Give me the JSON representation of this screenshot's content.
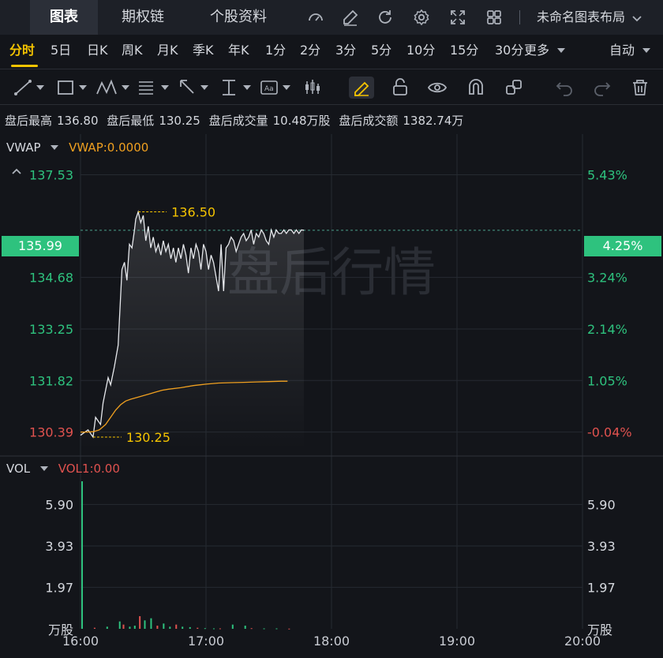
{
  "topbar": {
    "tabs": [
      "图表",
      "期权链",
      "个股资料"
    ],
    "active_tab": "图表",
    "icons": [
      "speedometer-icon",
      "pencil-icon",
      "refresh-icon",
      "gear-icon",
      "fullscreen-icon",
      "grid-icon"
    ],
    "layout_label": "未命名图表布局"
  },
  "periods": {
    "items": [
      "分时",
      "5日",
      "日K",
      "周K",
      "月K",
      "季K",
      "年K",
      "1分",
      "2分",
      "3分",
      "5分",
      "10分",
      "15分",
      "30分"
    ],
    "active": "分时",
    "more_label": "更多",
    "auto_label": "自动"
  },
  "tools": [
    "trendline-icon",
    "rectangle-icon",
    "pattern-icon",
    "fib-icon",
    "arrow-icon",
    "measure-icon",
    "text-icon",
    "candle-icon",
    "highlighter-icon",
    "lock-icon",
    "eye-icon",
    "magnet-icon",
    "link-icon",
    "undo-icon",
    "redo-icon",
    "trash-icon"
  ],
  "info": {
    "high_label": "盘后最高",
    "high_value": "136.80",
    "low_label": "盘后最低",
    "low_value": "130.25",
    "volume_label": "盘后成交量",
    "volume_value": "10.48万股",
    "amount_label": "盘后成交额",
    "amount_value": "1382.74万"
  },
  "indicators": {
    "main_name": "VWAP",
    "main_value": "VWAP:0.0000",
    "vol_name": "VOL",
    "vol_value": "VOL1:0.00"
  },
  "watermark": "盘后行情",
  "colors": {
    "up": "#2ec27e",
    "down": "#e0524f",
    "vwap": "#f0a020",
    "highlight": "#f5c400"
  },
  "chart_data": {
    "type": "line",
    "x_ticks": [
      "16:00",
      "17:00",
      "18:00",
      "19:00",
      "20:00"
    ],
    "price_ticks_left": [
      "137.53",
      "134.68",
      "133.25",
      "131.82",
      "130.39"
    ],
    "price_ticks_right": [
      "5.43%",
      "3.24%",
      "2.14%",
      "1.05%",
      "-0.04%"
    ],
    "current_price": "135.99",
    "current_pct": "4.25%",
    "max_marker": "136.50",
    "min_marker": "130.25",
    "ylim": [
      129.9,
      138.0
    ],
    "price_series": {
      "x": [
        0,
        0.06,
        0.1,
        0.12,
        0.16,
        0.18,
        0.22,
        0.24,
        0.27,
        0.3,
        0.33,
        0.35,
        0.37,
        0.39,
        0.41,
        0.43,
        0.44,
        0.46,
        0.48,
        0.5,
        0.52,
        0.54,
        0.56,
        0.58,
        0.6,
        0.62,
        0.64,
        0.66,
        0.68,
        0.7,
        0.72,
        0.74,
        0.76,
        0.78,
        0.8,
        0.82,
        0.84,
        0.86,
        0.88,
        0.9,
        0.92,
        0.94,
        0.96,
        0.98,
        1.0,
        1.02,
        1.04,
        1.06,
        1.08,
        1.1,
        1.12,
        1.14,
        1.16,
        1.18,
        1.2,
        1.22,
        1.24,
        1.26,
        1.28,
        1.3,
        1.32,
        1.34,
        1.36,
        1.38,
        1.4,
        1.42,
        1.44,
        1.46,
        1.48,
        1.5,
        1.52,
        1.54,
        1.56,
        1.58,
        1.6,
        1.62,
        1.64,
        1.66,
        1.68,
        1.7,
        1.72,
        1.74,
        1.76,
        1.78
      ],
      "y": [
        130.3,
        130.45,
        130.25,
        130.8,
        130.6,
        131.2,
        131.9,
        131.7,
        132.2,
        132.8,
        134.9,
        135.1,
        134.6,
        135.6,
        135.5,
        136.0,
        136.3,
        136.5,
        136.2,
        136.4,
        135.7,
        136.1,
        135.5,
        135.8,
        135.4,
        135.6,
        135.3,
        135.7,
        135.4,
        135.6,
        135.2,
        135.5,
        135.1,
        135.5,
        135.2,
        135.6,
        135.3,
        134.8,
        135.5,
        135.2,
        135.6,
        135.4,
        134.9,
        135.6,
        135.4,
        134.9,
        135.3,
        135.1,
        134.7,
        134.3,
        135.6,
        134.3,
        135.5,
        135.6,
        135.8,
        135.7,
        135.4,
        135.6,
        135.8,
        135.9,
        135.7,
        135.8,
        136.0,
        135.6,
        135.9,
        135.8,
        136.0,
        135.9,
        135.7,
        135.6,
        136.0,
        135.8,
        136.0,
        135.9,
        135.9,
        136.0,
        135.9,
        136.0,
        136.0,
        135.9,
        136.0,
        135.9,
        136.0,
        135.99
      ]
    },
    "vwap_series": {
      "x": [
        0,
        0.05,
        0.1,
        0.15,
        0.2,
        0.24,
        0.28,
        0.32,
        0.36,
        0.4,
        0.45,
        0.5,
        0.55,
        0.6,
        0.65,
        0.7,
        0.8,
        0.9,
        1.0,
        1.1,
        1.2,
        1.3,
        1.4,
        1.5,
        1.6,
        1.65
      ],
      "y": [
        130.39,
        130.39,
        130.4,
        130.45,
        130.6,
        130.8,
        131.0,
        131.15,
        131.25,
        131.3,
        131.35,
        131.4,
        131.45,
        131.5,
        131.55,
        131.58,
        131.62,
        131.68,
        131.72,
        131.75,
        131.76,
        131.77,
        131.78,
        131.79,
        131.8,
        131.8
      ]
    },
    "volume_ticks": [
      "5.90",
      "3.93",
      "1.97"
    ],
    "volume_unit": "万股",
    "volume_ylim": [
      0,
      7.0
    ],
    "volume_series": {
      "x": [
        0.0,
        0.1,
        0.2,
        0.3,
        0.33,
        0.38,
        0.42,
        0.46,
        0.5,
        0.55,
        0.6,
        0.65,
        0.7,
        0.75,
        0.8,
        0.86,
        0.92,
        0.98,
        1.05,
        1.1,
        1.2,
        1.3,
        1.35,
        1.45,
        1.55,
        1.65
      ],
      "y": [
        7.0,
        0.05,
        0.1,
        0.35,
        0.2,
        0.1,
        0.15,
        0.6,
        0.4,
        0.5,
        0.15,
        0.25,
        0.1,
        0.2,
        0.1,
        0.08,
        0.05,
        0.03,
        0.02,
        0.02,
        0.2,
        0.15,
        0.03,
        0.02,
        0.02,
        0.01
      ]
    }
  }
}
